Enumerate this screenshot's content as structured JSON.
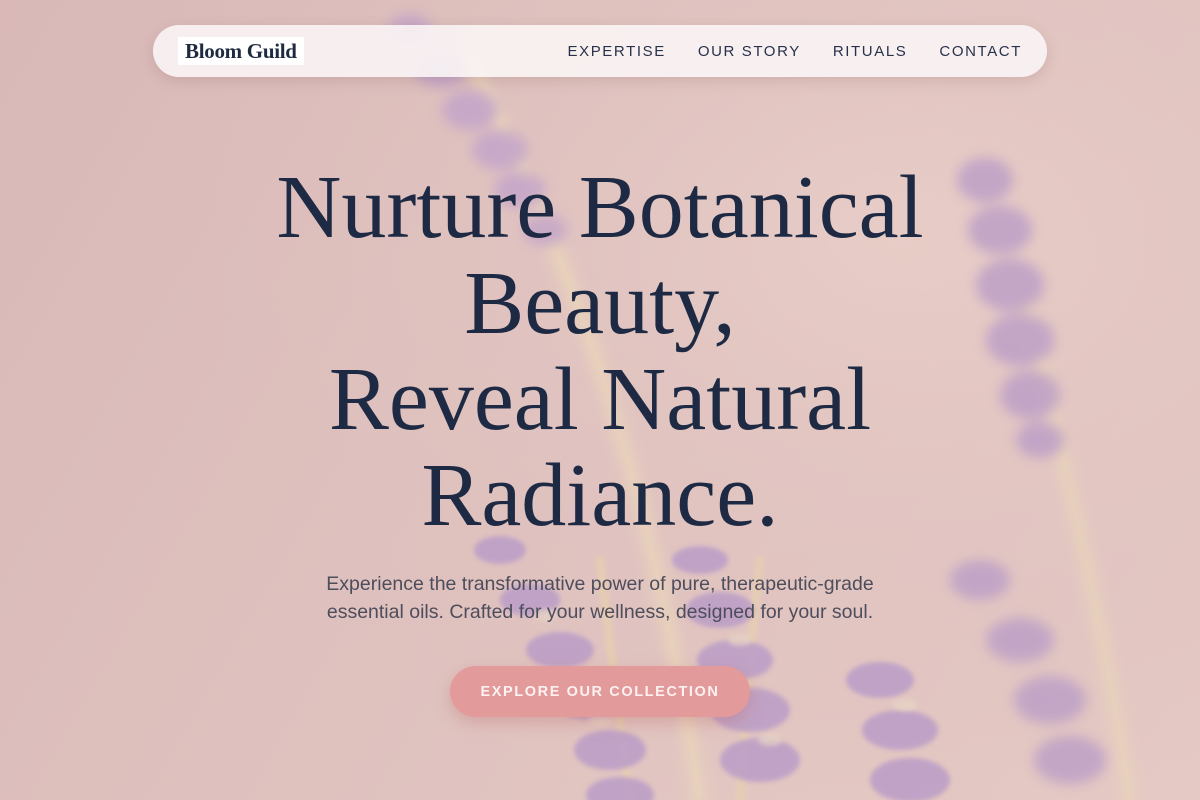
{
  "brand": {
    "name": "Bloom Guild"
  },
  "nav": {
    "links": [
      "EXPERTISE",
      "OUR STORY",
      "RITUALS",
      "CONTACT"
    ]
  },
  "hero": {
    "headline_lines": [
      "Nurture Botanical",
      "Beauty,",
      "Reveal Natural",
      "Radiance."
    ],
    "subtitle_lines": [
      "Experience the transformative power of pure, therapeutic-grade",
      "essential oils. Crafted for your wellness, designed for your soul."
    ],
    "cta_label": "EXPLORE OUR COLLECTION",
    "background_image": "lavender-flowers"
  },
  "colors": {
    "text_dark": "#1e2a44",
    "accent": "#e39a9b",
    "background": "#dcc0bd",
    "lavender": "#a88bc7"
  }
}
